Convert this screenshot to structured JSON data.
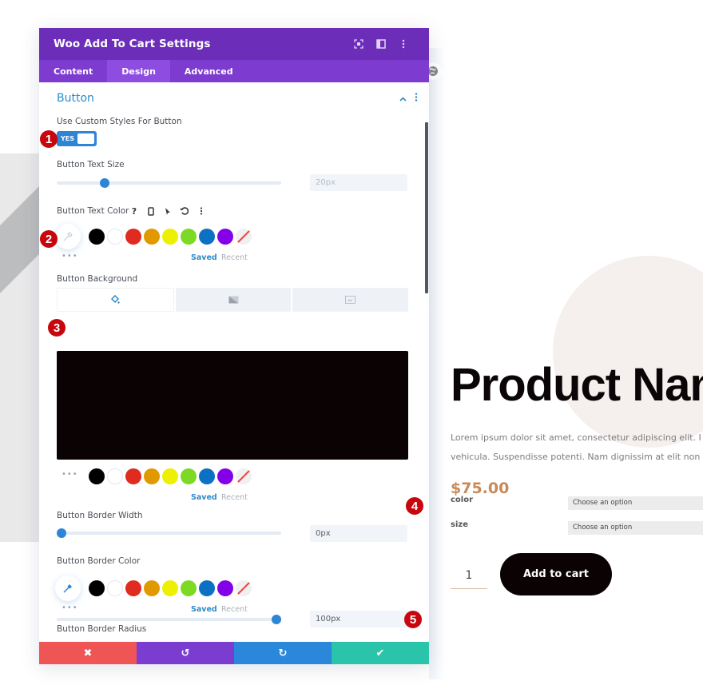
{
  "modal": {
    "title": "Woo Add To Cart Settings",
    "header_icons": [
      "expand-icon",
      "split-view-icon",
      "more-vertical-icon"
    ],
    "tabs": [
      {
        "label": "Content",
        "active": false
      },
      {
        "label": "Design",
        "active": true
      },
      {
        "label": "Advanced",
        "active": false
      }
    ],
    "section": {
      "title": "Button",
      "collapse_icon": "chevron-up-icon",
      "menu_icon": "more-vertical-icon"
    },
    "fields": {
      "custom_styles": {
        "label": "Use Custom Styles For Button",
        "toggle_text": "YES",
        "value": true
      },
      "text_size": {
        "label": "Button Text Size",
        "value": "20px",
        "slider_fraction": 0.2
      },
      "text_color": {
        "label": "Button Text Color",
        "tool_icons": [
          "help-icon",
          "mobile-icon",
          "hover-cursor-icon",
          "reset-icon",
          "more-vertical-icon"
        ]
      },
      "background": {
        "label": "Button Background",
        "tabs": [
          "color-fill-icon",
          "gradient-icon",
          "image-icon"
        ],
        "color": "#0a0203"
      },
      "border_width": {
        "label": "Button Border Width",
        "value": "0px",
        "slider_fraction": 0.0
      },
      "border_color": {
        "label": "Button Border Color"
      },
      "border_radius": {
        "label": "Button Border Radius",
        "value": "100px",
        "slider_fraction": 1.0
      }
    },
    "palette": [
      "#000000",
      "#ffffff",
      "#e02b20",
      "#e09900",
      "#edf000",
      "#7cda24",
      "#0c71c3",
      "#8300e9"
    ],
    "palette_none": "no-color",
    "saved_label": "Saved",
    "recent_label": "Recent",
    "more_dots": "•••",
    "footer": {
      "cancel": {
        "icon": "✖",
        "color": "#ef5555"
      },
      "undo": {
        "icon": "↺",
        "color": "#7b3dd0"
      },
      "redo": {
        "icon": "↻",
        "color": "#2b87da"
      },
      "save": {
        "icon": "✔",
        "color": "#29c4a9"
      }
    }
  },
  "badges": [
    "1",
    "2",
    "3",
    "4",
    "5"
  ],
  "product": {
    "title": "Product Name",
    "description_lines": [
      "Lorem ipsum dolor sit amet, consectetur adipiscing elit. I",
      "vehicula. Suspendisse potenti. Nam dignissim at elit non"
    ],
    "price": "$75.00",
    "attributes": [
      {
        "label": "color",
        "placeholder": "Choose an option"
      },
      {
        "label": "size",
        "placeholder": "Choose an option"
      }
    ],
    "quantity": "1",
    "add_to_cart": "Add to cart"
  }
}
